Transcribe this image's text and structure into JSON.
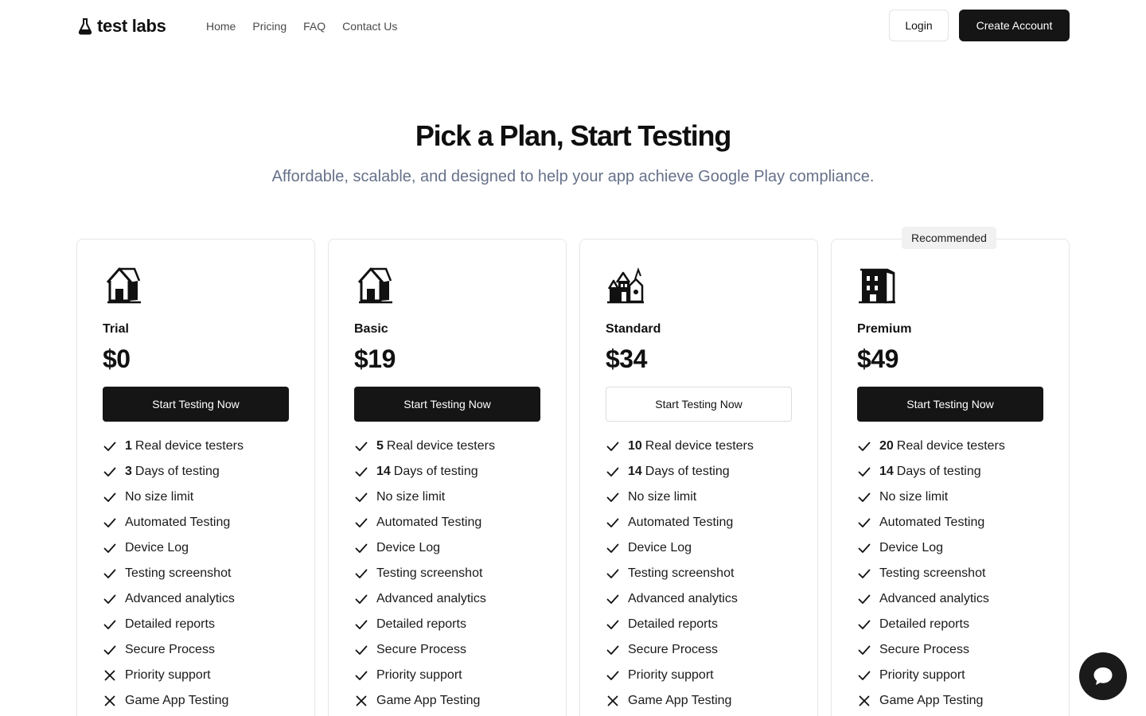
{
  "header": {
    "brand": "test labs",
    "nav": [
      "Home",
      "Pricing",
      "FAQ",
      "Contact Us"
    ],
    "login": "Login",
    "create_account": "Create Account"
  },
  "hero": {
    "title": "Pick a Plan, Start Testing",
    "subtitle": "Affordable, scalable, and designed to help your app achieve Google Play compliance."
  },
  "cta_label": "Start Testing Now",
  "plans": [
    {
      "name": "Trial",
      "price": "$0",
      "icon": "house-icon",
      "cta_style": "dark",
      "badge": "",
      "features": [
        {
          "num": "1",
          "text": "Real device testers",
          "included": true
        },
        {
          "num": "3",
          "text": "Days of testing",
          "included": true
        },
        {
          "num": "",
          "text": "No size limit",
          "included": true
        },
        {
          "num": "",
          "text": "Automated Testing",
          "included": true
        },
        {
          "num": "",
          "text": "Device Log",
          "included": true
        },
        {
          "num": "",
          "text": "Testing screenshot",
          "included": true
        },
        {
          "num": "",
          "text": "Advanced analytics",
          "included": true
        },
        {
          "num": "",
          "text": "Detailed reports",
          "included": true
        },
        {
          "num": "",
          "text": "Secure Process",
          "included": true
        },
        {
          "num": "",
          "text": "Priority support",
          "included": false
        },
        {
          "num": "",
          "text": "Game App Testing",
          "included": false
        }
      ]
    },
    {
      "name": "Basic",
      "price": "$19",
      "icon": "house-icon",
      "cta_style": "dark",
      "badge": "",
      "features": [
        {
          "num": "5",
          "text": "Real device testers",
          "included": true
        },
        {
          "num": "14",
          "text": "Days of testing",
          "included": true
        },
        {
          "num": "",
          "text": "No size limit",
          "included": true
        },
        {
          "num": "",
          "text": "Automated Testing",
          "included": true
        },
        {
          "num": "",
          "text": "Device Log",
          "included": true
        },
        {
          "num": "",
          "text": "Testing screenshot",
          "included": true
        },
        {
          "num": "",
          "text": "Advanced analytics",
          "included": true
        },
        {
          "num": "",
          "text": "Detailed reports",
          "included": true
        },
        {
          "num": "",
          "text": "Secure Process",
          "included": true
        },
        {
          "num": "",
          "text": "Priority support",
          "included": true
        },
        {
          "num": "",
          "text": "Game App Testing",
          "included": false
        }
      ]
    },
    {
      "name": "Standard",
      "price": "$34",
      "icon": "village-icon",
      "cta_style": "light",
      "badge": "",
      "features": [
        {
          "num": "10",
          "text": "Real device testers",
          "included": true
        },
        {
          "num": "14",
          "text": "Days of testing",
          "included": true
        },
        {
          "num": "",
          "text": "No size limit",
          "included": true
        },
        {
          "num": "",
          "text": "Automated Testing",
          "included": true
        },
        {
          "num": "",
          "text": "Device Log",
          "included": true
        },
        {
          "num": "",
          "text": "Testing screenshot",
          "included": true
        },
        {
          "num": "",
          "text": "Advanced analytics",
          "included": true
        },
        {
          "num": "",
          "text": "Detailed reports",
          "included": true
        },
        {
          "num": "",
          "text": "Secure Process",
          "included": true
        },
        {
          "num": "",
          "text": "Priority support",
          "included": true
        },
        {
          "num": "",
          "text": "Game App Testing",
          "included": false
        }
      ]
    },
    {
      "name": "Premium",
      "price": "$49",
      "icon": "building-icon",
      "cta_style": "dark",
      "badge": "Recommended",
      "features": [
        {
          "num": "20",
          "text": "Real device testers",
          "included": true
        },
        {
          "num": "14",
          "text": "Days of testing",
          "included": true
        },
        {
          "num": "",
          "text": "No size limit",
          "included": true
        },
        {
          "num": "",
          "text": "Automated Testing",
          "included": true
        },
        {
          "num": "",
          "text": "Device Log",
          "included": true
        },
        {
          "num": "",
          "text": "Testing screenshot",
          "included": true
        },
        {
          "num": "",
          "text": "Advanced analytics",
          "included": true
        },
        {
          "num": "",
          "text": "Detailed reports",
          "included": true
        },
        {
          "num": "",
          "text": "Secure Process",
          "included": true
        },
        {
          "num": "",
          "text": "Priority support",
          "included": true
        },
        {
          "num": "",
          "text": "Game App Testing",
          "included": false
        }
      ]
    }
  ],
  "icons": {
    "brand": "flask-icon",
    "included": "check-icon",
    "excluded": "x-icon",
    "chat": "chat-bubble-icon"
  },
  "colors": {
    "primary": "#151515",
    "subtitle": "#66718a",
    "border": "#e6e6e6",
    "badge_bg": "#f1f1f1"
  }
}
